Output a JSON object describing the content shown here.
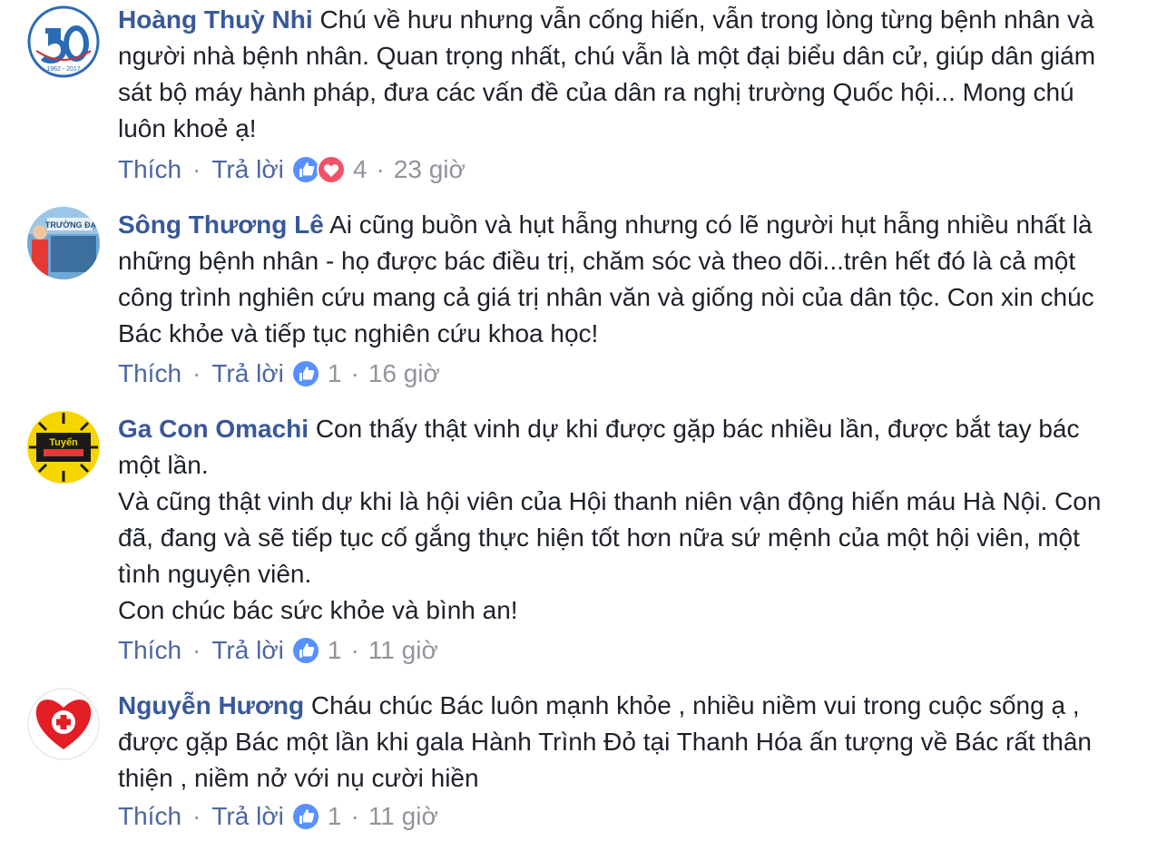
{
  "comments": [
    {
      "author": "Hoàng Thuỳ Nhi",
      "avatar_text": "1962 - 2017",
      "paragraphs": [
        "Chú về hưu nhưng vẫn cống hiến, vẫn trong lòng từng bệnh nhân và người nhà bệnh nhân. Quan trọng nhất, chú vẫn là một đại biểu dân cử, giúp dân giám sát bộ máy hành pháp, đưa các vấn đề của dân ra nghị trường Quốc hội... Mong chú luôn khoẻ ạ!"
      ],
      "like_label": "Thích",
      "reply_label": "Trả lời",
      "reaction_icons": [
        "like-icon",
        "love-icon"
      ],
      "reaction_count": "4",
      "time": "23 giờ"
    },
    {
      "author": "Sông Thương Lê",
      "avatar_text": "TRƯỜNG ĐẠ",
      "paragraphs": [
        "Ai cũng buồn và hụt hẫng nhưng có lẽ người hụt hẫng nhiều nhất là những bệnh nhân - họ được bác điều trị, chăm sóc và theo dõi...trên hết đó là cả một công trình nghiên cứu mang cả giá trị nhân văn và giống nòi của dân tộc. Con xin chúc Bác khỏe và tiếp tục nghiên cứu khoa học!"
      ],
      "like_label": "Thích",
      "reply_label": "Trả lời",
      "reaction_icons": [
        "like-icon"
      ],
      "reaction_count": "1",
      "time": "16 giờ"
    },
    {
      "author": "Ga Con Omachi",
      "avatar_text": "Tuyển",
      "paragraphs": [
        "Con thấy thật vinh dự khi được gặp bác nhiều lần, được bắt tay bác một lần.",
        "Và cũng thật vinh dự khi là hội viên của Hội thanh niên vận động hiến máu Hà Nội. Con đã, đang và sẽ tiếp tục cố gắng thực hiện tốt hơn nữa sứ mệnh của một hội viên, một tình nguyện viên.",
        "Con chúc bác sức khỏe và bình an!"
      ],
      "like_label": "Thích",
      "reply_label": "Trả lời",
      "reaction_icons": [
        "like-icon"
      ],
      "reaction_count": "1",
      "time": "11 giờ"
    },
    {
      "author": "Nguyễn Hương",
      "paragraphs": [
        "Cháu chúc Bác luôn mạnh khỏe , nhiều niềm vui trong cuộc sống ạ , được gặp Bác một lần khi gala Hành Trình Đỏ tại Thanh Hóa ấn tượng về Bác rất thân thiện , niềm nở với nụ cười hiền"
      ],
      "like_label": "Thích",
      "reply_label": "Trả lời",
      "reaction_icons": [
        "like-icon"
      ],
      "reaction_count": "1",
      "time": "11 giờ"
    }
  ],
  "colors": {
    "author": "#385898",
    "action_link": "#4b67a1",
    "meta": "#90949c",
    "body_text": "#1d2129",
    "like_blue": "#5890ff",
    "love_red": "#f25268"
  }
}
